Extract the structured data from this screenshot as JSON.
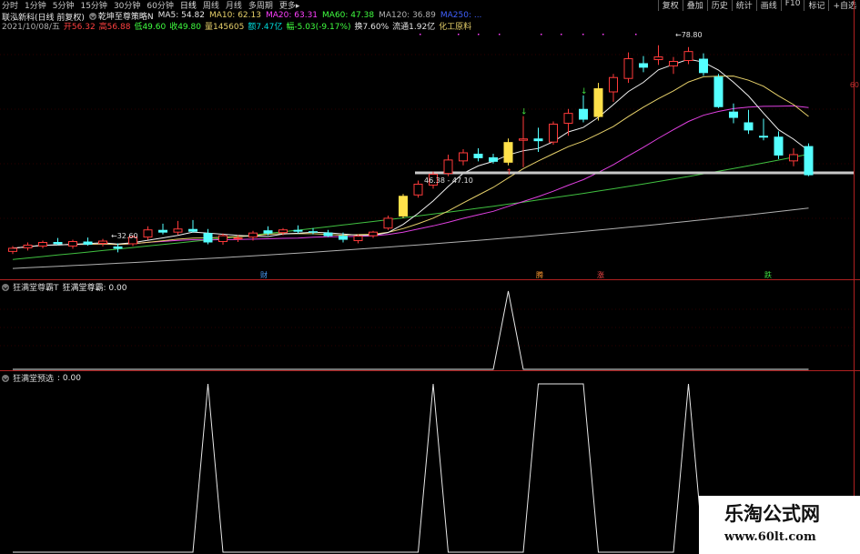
{
  "toolbar": {
    "periods": [
      "分时",
      "1分钟",
      "5分钟",
      "15分钟",
      "30分钟",
      "60分钟",
      "日线",
      "周线",
      "月线",
      "多周期",
      "更多"
    ],
    "active_period": "日线",
    "right_buttons": [
      "复权",
      "叠加",
      "历史",
      "统计",
      "画线",
      "F10",
      "标记",
      "+自选"
    ]
  },
  "stock": {
    "name": "联泓新科(日线 前复权)",
    "formula": "乾坤至尊策略N",
    "ma5": "MA5: 54.82",
    "ma10": "MA10: 62.13",
    "ma20": "MA20: 63.31",
    "ma60": "MA60: 47.38",
    "ma120": "MA120: 36.89",
    "ma250": "MA250: ..."
  },
  "quote": {
    "date": "2021/10/08/五",
    "open": "开56.32",
    "high": "高56.88",
    "low": "低49.60",
    "close": "收49.80",
    "volume": "量145605",
    "amount": "额7.47亿",
    "change": "幅-5.03(-9.17%)",
    "turnover": "换7.60%",
    "float": "流通1.92亿",
    "sector": "化工原料"
  },
  "annotations": {
    "high_label": "78.80",
    "low_label": "32.60",
    "range_label": "46.38 - 47.10",
    "marker_cai": "财",
    "marker_teng": "腾",
    "marker_zhang": "涨",
    "marker_die": "跌",
    "right_axis_label": "60"
  },
  "panel2": {
    "name": "狂满堂尊霸T",
    "value_label": "狂满堂尊霸: 0.00"
  },
  "panel3": {
    "name": "狂满堂预选",
    "value_label": ": 0.00"
  },
  "watermark": {
    "title": "乐淘公式网",
    "url": "www.60lt.com"
  },
  "colors": {
    "up": "#ff3a3a",
    "down": "#54ffff",
    "signal": "#ffe14a",
    "ma5": "#f0f0f0",
    "ma10": "#e6d06a",
    "ma20": "#e040e0",
    "ma60": "#40c040",
    "ma120": "#b0b0b0"
  },
  "candles": [
    {
      "o": 32.8,
      "h": 34.0,
      "l": 32.2,
      "c": 33.5
    },
    {
      "o": 33.6,
      "h": 34.8,
      "l": 33.0,
      "c": 34.2
    },
    {
      "o": 34.0,
      "h": 35.2,
      "l": 33.5,
      "c": 34.8
    },
    {
      "o": 34.9,
      "h": 35.8,
      "l": 34.2,
      "c": 34.4
    },
    {
      "o": 34.0,
      "h": 35.4,
      "l": 33.4,
      "c": 35.0
    },
    {
      "o": 35.0,
      "h": 35.9,
      "l": 34.1,
      "c": 34.3
    },
    {
      "o": 34.6,
      "h": 35.6,
      "l": 33.9,
      "c": 35.1
    },
    {
      "o": 33.9,
      "h": 34.6,
      "l": 32.6,
      "c": 33.4
    },
    {
      "o": 34.5,
      "h": 36.4,
      "l": 34.0,
      "c": 36.0
    },
    {
      "o": 36.0,
      "h": 38.4,
      "l": 35.4,
      "c": 37.6
    },
    {
      "o": 37.6,
      "h": 39.0,
      "l": 36.6,
      "c": 37.0
    },
    {
      "o": 37.1,
      "h": 39.6,
      "l": 36.5,
      "c": 37.8
    },
    {
      "o": 37.8,
      "h": 39.8,
      "l": 37.0,
      "c": 37.2
    },
    {
      "o": 36.9,
      "h": 37.8,
      "l": 34.4,
      "c": 34.8
    },
    {
      "o": 35.0,
      "h": 36.8,
      "l": 34.3,
      "c": 36.3
    },
    {
      "o": 35.6,
      "h": 36.4,
      "l": 34.9,
      "c": 35.8
    },
    {
      "o": 36.0,
      "h": 37.4,
      "l": 35.2,
      "c": 36.9
    },
    {
      "o": 37.5,
      "h": 38.4,
      "l": 36.4,
      "c": 36.8
    },
    {
      "o": 37.0,
      "h": 38.0,
      "l": 36.4,
      "c": 37.6
    },
    {
      "o": 37.6,
      "h": 38.6,
      "l": 36.8,
      "c": 37.2
    },
    {
      "o": 37.3,
      "h": 38.0,
      "l": 36.6,
      "c": 37.0
    },
    {
      "o": 37.0,
      "h": 37.6,
      "l": 36.0,
      "c": 36.2
    },
    {
      "o": 36.3,
      "h": 37.0,
      "l": 34.8,
      "c": 35.4
    },
    {
      "o": 35.2,
      "h": 36.6,
      "l": 34.6,
      "c": 36.2
    },
    {
      "o": 36.3,
      "h": 37.4,
      "l": 35.8,
      "c": 37.1
    },
    {
      "o": 38.0,
      "h": 40.8,
      "l": 37.6,
      "c": 40.2
    },
    {
      "o": 40.6,
      "h": 45.6,
      "l": 40.2,
      "c": 45.2
    },
    {
      "o": 45.4,
      "h": 48.6,
      "l": 44.8,
      "c": 47.8
    },
    {
      "o": 47.6,
      "h": 50.6,
      "l": 46.8,
      "c": 50.0
    },
    {
      "o": 50.2,
      "h": 54.4,
      "l": 49.6,
      "c": 53.2
    },
    {
      "o": 53.0,
      "h": 55.6,
      "l": 52.0,
      "c": 54.8
    },
    {
      "o": 54.6,
      "h": 55.8,
      "l": 52.9,
      "c": 53.6
    },
    {
      "o": 53.8,
      "h": 54.6,
      "l": 52.4,
      "c": 52.8
    },
    {
      "o": 52.6,
      "h": 58.0,
      "l": 52.0,
      "c": 57.2
    },
    {
      "o": 57.6,
      "h": 63.0,
      "l": 51.6,
      "c": 57.9
    },
    {
      "o": 58.0,
      "h": 60.4,
      "l": 55.0,
      "c": 57.4
    },
    {
      "o": 57.2,
      "h": 61.8,
      "l": 56.6,
      "c": 61.2
    },
    {
      "o": 61.4,
      "h": 64.6,
      "l": 58.6,
      "c": 63.6
    },
    {
      "o": 64.6,
      "h": 67.6,
      "l": 61.6,
      "c": 62.2
    },
    {
      "o": 62.8,
      "h": 70.4,
      "l": 62.0,
      "c": 69.2
    },
    {
      "o": 68.4,
      "h": 72.4,
      "l": 66.2,
      "c": 71.6
    },
    {
      "o": 71.4,
      "h": 77.2,
      "l": 70.4,
      "c": 75.8
    },
    {
      "o": 74.8,
      "h": 76.4,
      "l": 72.8,
      "c": 73.8
    },
    {
      "o": 75.6,
      "h": 78.8,
      "l": 74.4,
      "c": 76.2
    },
    {
      "o": 74.2,
      "h": 76.2,
      "l": 72.4,
      "c": 75.2
    },
    {
      "o": 75.4,
      "h": 78.4,
      "l": 74.6,
      "c": 77.4
    },
    {
      "o": 75.8,
      "h": 77.0,
      "l": 72.0,
      "c": 72.6
    },
    {
      "o": 71.8,
      "h": 72.4,
      "l": 64.8,
      "c": 65.0
    },
    {
      "o": 64.0,
      "h": 65.8,
      "l": 61.4,
      "c": 62.6
    },
    {
      "o": 61.6,
      "h": 64.4,
      "l": 59.0,
      "c": 59.8
    },
    {
      "o": 58.6,
      "h": 62.4,
      "l": 57.6,
      "c": 58.2
    },
    {
      "o": 58.4,
      "h": 59.6,
      "l": 53.4,
      "c": 54.2
    },
    {
      "o": 53.0,
      "h": 55.8,
      "l": 51.8,
      "c": 54.4
    },
    {
      "o": 56.3,
      "h": 56.9,
      "l": 49.6,
      "c": 49.8
    }
  ],
  "signal_indices": [
    26,
    33,
    39
  ],
  "panel2_series": [
    0,
    0,
    0,
    0,
    0,
    0,
    0,
    0,
    0,
    0,
    0,
    0,
    0,
    0,
    0,
    0,
    0,
    0,
    0,
    0,
    0,
    0,
    0,
    0,
    0,
    0,
    0,
    0,
    0,
    0,
    0,
    0,
    0,
    1,
    0,
    0,
    0,
    0,
    0,
    0,
    0,
    0,
    0,
    0,
    0,
    0,
    0,
    0,
    0,
    0,
    0,
    0,
    0,
    0
  ],
  "panel3_series": [
    0,
    0,
    0,
    0,
    0,
    0,
    0,
    0,
    0,
    0,
    0,
    0,
    0,
    1,
    0,
    0,
    0,
    0,
    0,
    0,
    0,
    0,
    0,
    0,
    0,
    0,
    0,
    0,
    1,
    0,
    0,
    0,
    0,
    0,
    0,
    1,
    1,
    1,
    1,
    0,
    0,
    0,
    0,
    0,
    0,
    1,
    0,
    0,
    0,
    0,
    0,
    0,
    0,
    0
  ]
}
